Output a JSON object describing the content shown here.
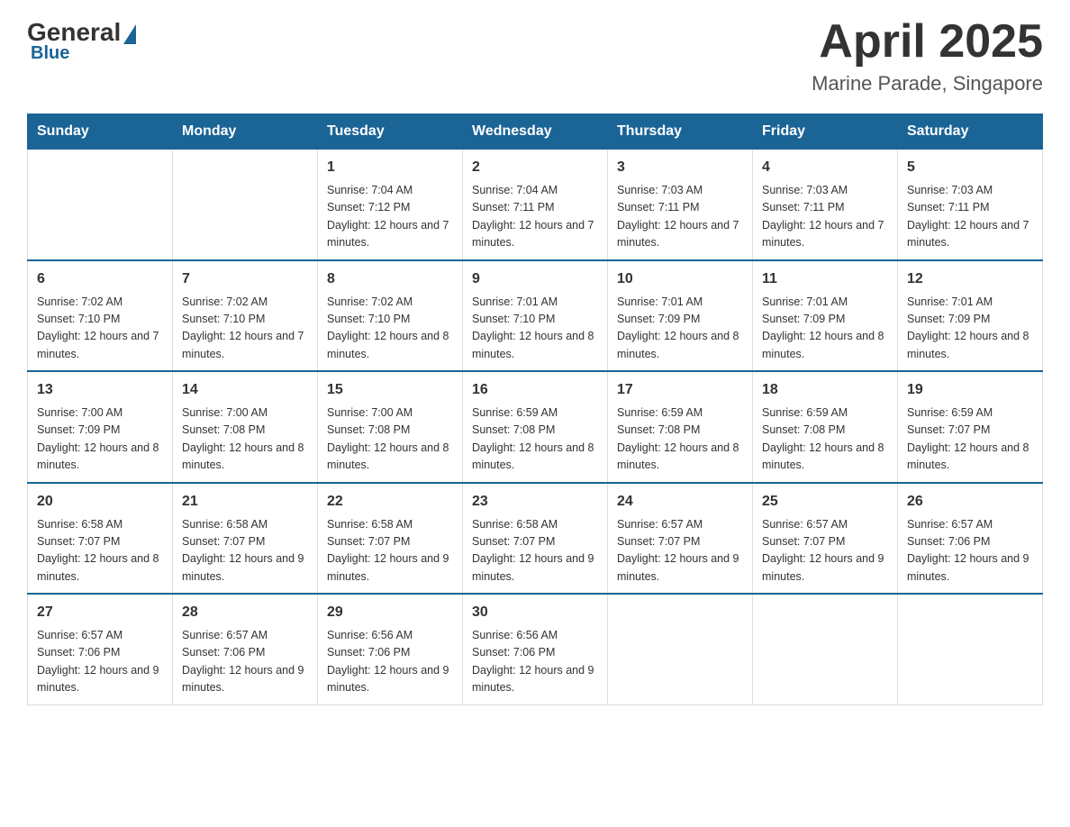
{
  "header": {
    "logo": {
      "general": "General",
      "blue": "Blue"
    },
    "title": "April 2025",
    "location": "Marine Parade, Singapore"
  },
  "weekdays": [
    "Sunday",
    "Monday",
    "Tuesday",
    "Wednesday",
    "Thursday",
    "Friday",
    "Saturday"
  ],
  "weeks": [
    [
      {
        "day": "",
        "info": ""
      },
      {
        "day": "",
        "info": ""
      },
      {
        "day": "1",
        "info": "Sunrise: 7:04 AM\nSunset: 7:12 PM\nDaylight: 12 hours\nand 7 minutes."
      },
      {
        "day": "2",
        "info": "Sunrise: 7:04 AM\nSunset: 7:11 PM\nDaylight: 12 hours\nand 7 minutes."
      },
      {
        "day": "3",
        "info": "Sunrise: 7:03 AM\nSunset: 7:11 PM\nDaylight: 12 hours\nand 7 minutes."
      },
      {
        "day": "4",
        "info": "Sunrise: 7:03 AM\nSunset: 7:11 PM\nDaylight: 12 hours\nand 7 minutes."
      },
      {
        "day": "5",
        "info": "Sunrise: 7:03 AM\nSunset: 7:11 PM\nDaylight: 12 hours\nand 7 minutes."
      }
    ],
    [
      {
        "day": "6",
        "info": "Sunrise: 7:02 AM\nSunset: 7:10 PM\nDaylight: 12 hours\nand 7 minutes."
      },
      {
        "day": "7",
        "info": "Sunrise: 7:02 AM\nSunset: 7:10 PM\nDaylight: 12 hours\nand 7 minutes."
      },
      {
        "day": "8",
        "info": "Sunrise: 7:02 AM\nSunset: 7:10 PM\nDaylight: 12 hours\nand 8 minutes."
      },
      {
        "day": "9",
        "info": "Sunrise: 7:01 AM\nSunset: 7:10 PM\nDaylight: 12 hours\nand 8 minutes."
      },
      {
        "day": "10",
        "info": "Sunrise: 7:01 AM\nSunset: 7:09 PM\nDaylight: 12 hours\nand 8 minutes."
      },
      {
        "day": "11",
        "info": "Sunrise: 7:01 AM\nSunset: 7:09 PM\nDaylight: 12 hours\nand 8 minutes."
      },
      {
        "day": "12",
        "info": "Sunrise: 7:01 AM\nSunset: 7:09 PM\nDaylight: 12 hours\nand 8 minutes."
      }
    ],
    [
      {
        "day": "13",
        "info": "Sunrise: 7:00 AM\nSunset: 7:09 PM\nDaylight: 12 hours\nand 8 minutes."
      },
      {
        "day": "14",
        "info": "Sunrise: 7:00 AM\nSunset: 7:08 PM\nDaylight: 12 hours\nand 8 minutes."
      },
      {
        "day": "15",
        "info": "Sunrise: 7:00 AM\nSunset: 7:08 PM\nDaylight: 12 hours\nand 8 minutes."
      },
      {
        "day": "16",
        "info": "Sunrise: 6:59 AM\nSunset: 7:08 PM\nDaylight: 12 hours\nand 8 minutes."
      },
      {
        "day": "17",
        "info": "Sunrise: 6:59 AM\nSunset: 7:08 PM\nDaylight: 12 hours\nand 8 minutes."
      },
      {
        "day": "18",
        "info": "Sunrise: 6:59 AM\nSunset: 7:08 PM\nDaylight: 12 hours\nand 8 minutes."
      },
      {
        "day": "19",
        "info": "Sunrise: 6:59 AM\nSunset: 7:07 PM\nDaylight: 12 hours\nand 8 minutes."
      }
    ],
    [
      {
        "day": "20",
        "info": "Sunrise: 6:58 AM\nSunset: 7:07 PM\nDaylight: 12 hours\nand 8 minutes."
      },
      {
        "day": "21",
        "info": "Sunrise: 6:58 AM\nSunset: 7:07 PM\nDaylight: 12 hours\nand 9 minutes."
      },
      {
        "day": "22",
        "info": "Sunrise: 6:58 AM\nSunset: 7:07 PM\nDaylight: 12 hours\nand 9 minutes."
      },
      {
        "day": "23",
        "info": "Sunrise: 6:58 AM\nSunset: 7:07 PM\nDaylight: 12 hours\nand 9 minutes."
      },
      {
        "day": "24",
        "info": "Sunrise: 6:57 AM\nSunset: 7:07 PM\nDaylight: 12 hours\nand 9 minutes."
      },
      {
        "day": "25",
        "info": "Sunrise: 6:57 AM\nSunset: 7:07 PM\nDaylight: 12 hours\nand 9 minutes."
      },
      {
        "day": "26",
        "info": "Sunrise: 6:57 AM\nSunset: 7:06 PM\nDaylight: 12 hours\nand 9 minutes."
      }
    ],
    [
      {
        "day": "27",
        "info": "Sunrise: 6:57 AM\nSunset: 7:06 PM\nDaylight: 12 hours\nand 9 minutes."
      },
      {
        "day": "28",
        "info": "Sunrise: 6:57 AM\nSunset: 7:06 PM\nDaylight: 12 hours\nand 9 minutes."
      },
      {
        "day": "29",
        "info": "Sunrise: 6:56 AM\nSunset: 7:06 PM\nDaylight: 12 hours\nand 9 minutes."
      },
      {
        "day": "30",
        "info": "Sunrise: 6:56 AM\nSunset: 7:06 PM\nDaylight: 12 hours\nand 9 minutes."
      },
      {
        "day": "",
        "info": ""
      },
      {
        "day": "",
        "info": ""
      },
      {
        "day": "",
        "info": ""
      }
    ]
  ]
}
